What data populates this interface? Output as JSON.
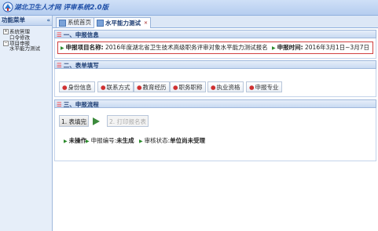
{
  "app": {
    "title": "湖北卫生人才网 评审系统2.0版"
  },
  "sidebar": {
    "header": "功能菜单",
    "items": [
      {
        "label": "系统管理"
      },
      {
        "label": "口令修改"
      },
      {
        "label": "项目申报"
      },
      {
        "label": "水平能力测试"
      }
    ]
  },
  "tabs": [
    {
      "label": "系统首页"
    },
    {
      "label": "水平能力测试"
    }
  ],
  "sections": {
    "s1": "一、申报信息",
    "s2": "二、表单填写",
    "s3": "三、申报流程"
  },
  "info": {
    "project_label": "申报项目名称:",
    "project_value": "2016年度湖北省卫生技术高级职务评审对象水平能力测试报名",
    "time_label": "申报时间:",
    "time_value": "2016年3月1日~3月7日"
  },
  "form_buttons": [
    "身份信息",
    "联系方式",
    "教育经历",
    "职务职称",
    "执业资格",
    "申报专业"
  ],
  "steps": {
    "step1": "1. 表填完",
    "step2": "2. 打印报名表"
  },
  "status": {
    "op_label": "未操作",
    "num_label": "申报编号:",
    "num_value": "未生成",
    "state_label": "审核状态:",
    "state_value": "单位尚未受理"
  }
}
